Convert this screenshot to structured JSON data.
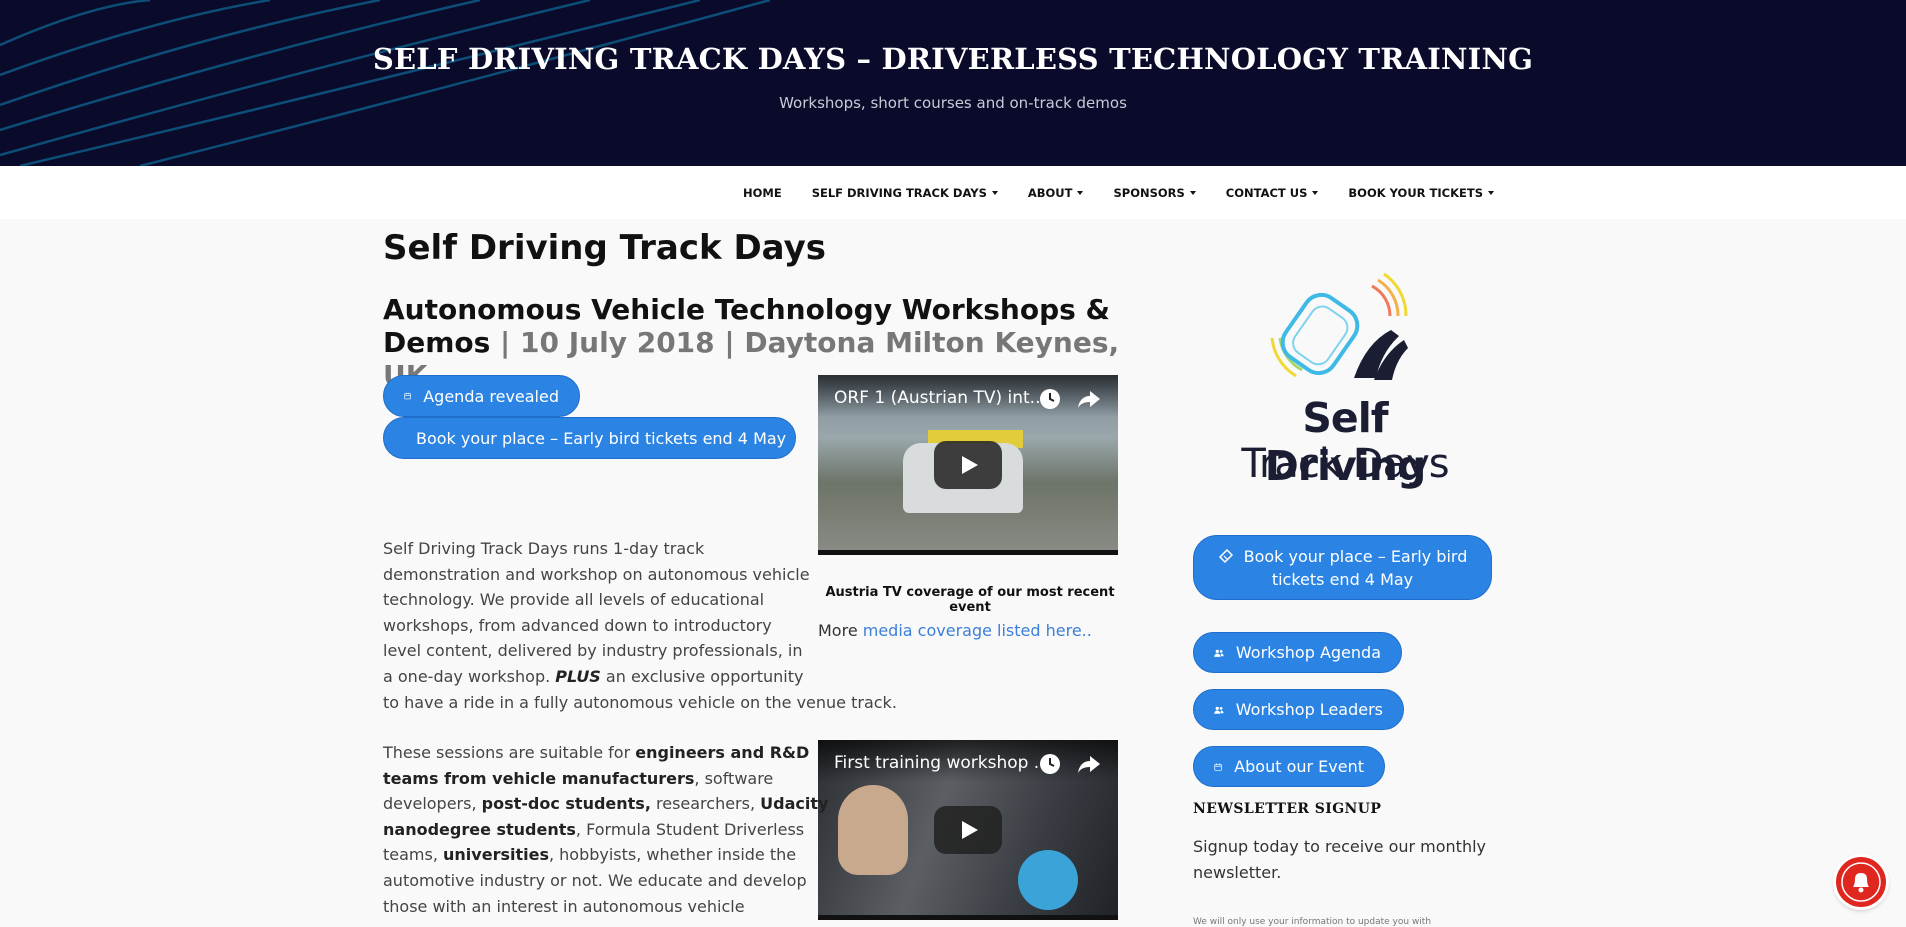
{
  "header": {
    "title": "SELF DRIVING TRACK DAYS – DRIVERLESS TECHNOLOGY TRAINING",
    "description": "Workshops, short courses and on-track demos"
  },
  "nav": {
    "items": [
      {
        "label": "HOME",
        "has_dropdown": false
      },
      {
        "label": "SELF DRIVING TRACK DAYS",
        "has_dropdown": true
      },
      {
        "label": "ABOUT",
        "has_dropdown": true
      },
      {
        "label": "SPONSORS",
        "has_dropdown": true
      },
      {
        "label": "CONTACT US",
        "has_dropdown": true
      },
      {
        "label": "BOOK YOUR TICKETS",
        "has_dropdown": true
      }
    ]
  },
  "main": {
    "page_title": "Self Driving Track Days",
    "hero_heading": "Autonomous Vehicle Technology Workshops & Demos",
    "hero_sep1": " | ",
    "hero_date": "10 July 2018",
    "hero_sep2": " | ",
    "hero_venue": "Daytona Milton Keynes, UK",
    "btn_agenda": "Agenda revealed",
    "btn_book": "Book your place – Early bird tickets end 4 May",
    "video1_title": "ORF 1 (Austrian TV) int...",
    "video1_caption": "Austria TV coverage of our most recent event",
    "more_prefix": "More ",
    "more_link": "media coverage listed here..",
    "video2_title": "First training workshop ...",
    "para1": {
      "line1": "Self Driving Track Days runs 1-day track",
      "line2": "demonstration and workshop on autonomous vehicle",
      "line3": "technology. We provide all levels of educational",
      "line4": "workshops, from advanced down to introductory",
      "line5": "level content, delivered by industry professionals, in",
      "line6a": "a one-day workshop. ",
      "line6b": "PLUS",
      "line6c": " an exclusive opportunity",
      "line7": "to have a ride in a fully autonomous vehicle on the venue track."
    },
    "para2": {
      "a": "These sessions are suitable for ",
      "b": "engineers and R&D",
      "c": "teams from vehicle manufacturers",
      "d": ", software",
      "e": "developers, ",
      "f": "post-doc students,",
      "g": " researchers, ",
      "h": "Udacity",
      "i": "nanodegree students",
      "j": ", Formula Student Driverless",
      "k": "teams, ",
      "l": "universities",
      "m": ", hobbyists, whether inside the",
      "n": "automotive industry or not. We educate and develop",
      "o": "those with an interest in autonomous vehicle"
    }
  },
  "sidebar": {
    "logo_line1": "Self Driving",
    "logo_line2": "Track Days",
    "btn_book_line1": "Book your place – Early bird",
    "btn_book_line2": "tickets end 4 May",
    "btn_agenda": "Workshop Agenda",
    "btn_leaders": "Workshop Leaders",
    "btn_about": "About our Event",
    "newsletter_heading": "NEWSLETTER SIGNUP",
    "newsletter_text": "Signup today to receive our monthly newsletter.",
    "newsletter_small": "We will only use your information to update you with"
  },
  "colors": {
    "header_bg": "#0a0a2b",
    "button_blue": "#2b84e4",
    "link_blue": "#3b7fd9",
    "notification_red": "#e0271f"
  }
}
